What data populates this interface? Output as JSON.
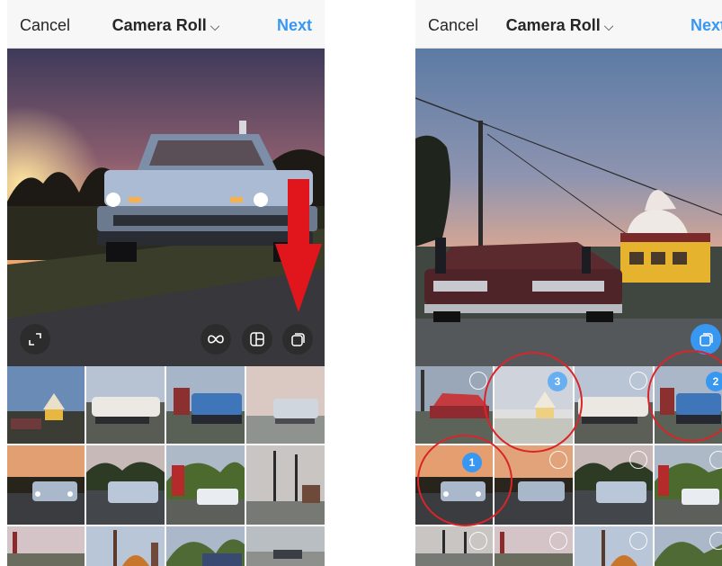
{
  "left_screen": {
    "header": {
      "cancel": "Cancel",
      "title": "Camera Roll",
      "next": "Next"
    },
    "preview": {
      "tools": [
        "expand-icon",
        "boomerang-icon",
        "layout-icon",
        "multi-select-icon"
      ]
    },
    "annotation": "red-arrow-pointing-to-multi-select"
  },
  "right_screen": {
    "header": {
      "cancel": "Cancel",
      "title": "Camera Roll",
      "next": "Next"
    },
    "preview": {
      "tools": [
        "multi-select-icon"
      ]
    },
    "selections": [
      {
        "number": "3"
      },
      {
        "number": "2"
      },
      {
        "number": "1"
      }
    ]
  },
  "colors": {
    "accent": "#3897f0",
    "annotation": "#d9252a"
  }
}
